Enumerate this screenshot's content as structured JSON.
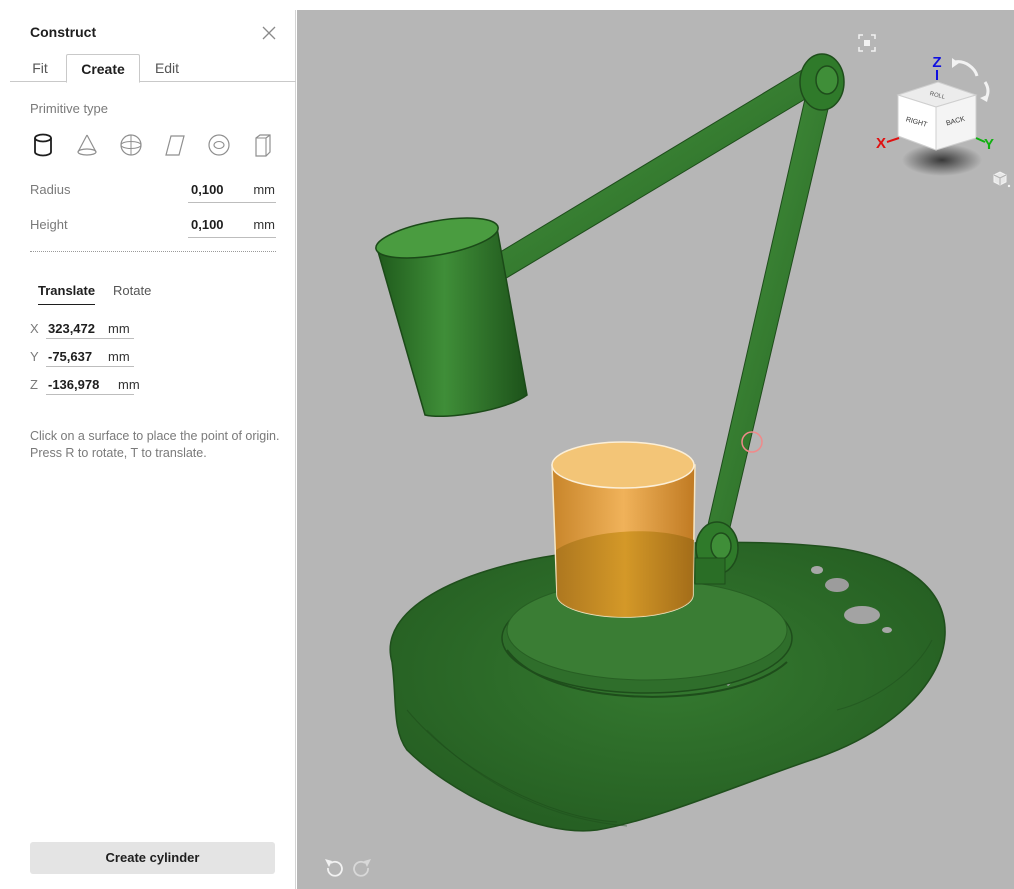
{
  "panel": {
    "title": "Construct",
    "tabs": [
      "Fit",
      "Create",
      "Edit"
    ],
    "active_tab": "Create",
    "primitive_type_label": "Primitive type",
    "primitives": [
      "cylinder-icon",
      "cone-icon",
      "sphere-icon",
      "plane-icon",
      "torus-icon",
      "box-icon"
    ],
    "selected_primitive": "cylinder-icon",
    "radius": {
      "label": "Radius",
      "value": "0,100",
      "unit": "mm"
    },
    "height": {
      "label": "Height",
      "value": "0,100",
      "unit": "mm"
    },
    "transform_tabs": [
      "Translate",
      "Rotate"
    ],
    "active_transform_tab": "Translate",
    "coords": [
      {
        "axis": "X",
        "value": "323,472",
        "unit": "mm"
      },
      {
        "axis": "Y",
        "value": "-75,637",
        "unit": "mm"
      },
      {
        "axis": "Z",
        "value": "-136,978",
        "unit": "mm"
      }
    ],
    "hint": "Click on a surface to place the point of origin. Press R to rotate, T to translate.",
    "create_button": "Create cylinder"
  },
  "viewcube": {
    "axis_labels": [
      "Z",
      "X",
      "Y"
    ],
    "face_labels": [
      "RIGHT",
      "BACK",
      "ROLL"
    ],
    "axis_colors": {
      "x": "#e01010",
      "y": "#10b010",
      "z": "#1010e0"
    }
  },
  "viewport": {
    "background": "#b6b6b6",
    "model_color": "#2f7a2a",
    "primitive_color": "#e2a23c"
  }
}
